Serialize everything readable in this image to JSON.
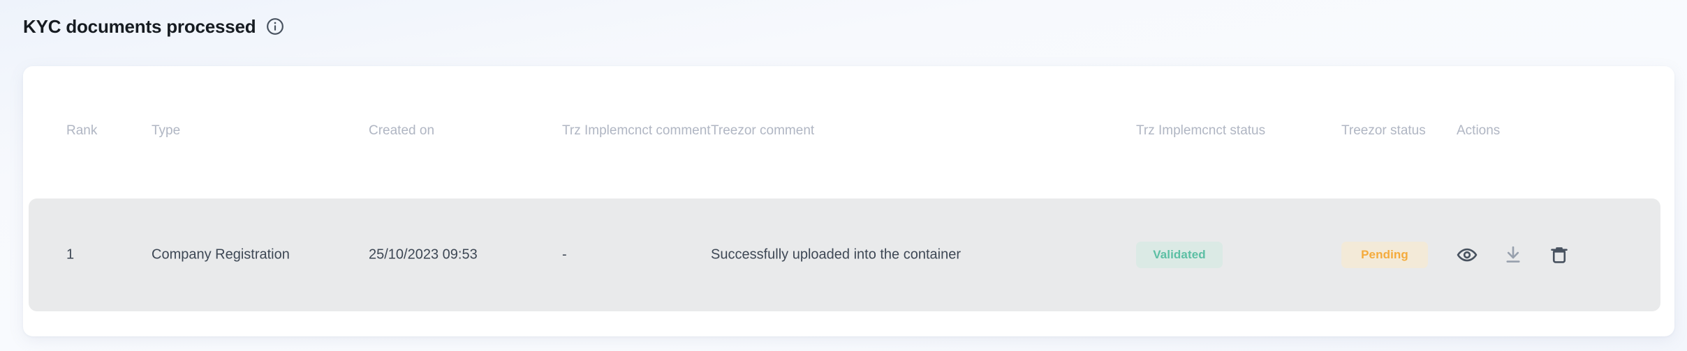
{
  "section": {
    "title": "KYC documents processed",
    "info_icon": "info-circle-icon"
  },
  "table": {
    "columns": [
      {
        "key": "rank",
        "label": "Rank"
      },
      {
        "key": "type",
        "label": "Type"
      },
      {
        "key": "created_on",
        "label": "Created on"
      },
      {
        "key": "trz_implemcnct_comment",
        "label": "Trz Implemcnct comment"
      },
      {
        "key": "treezor_comment",
        "label": "Treezor comment"
      },
      {
        "key": "trz_implemcnct_status",
        "label": "Trz Implemcnct status"
      },
      {
        "key": "treezor_status",
        "label": "Treezor status"
      },
      {
        "key": "actions",
        "label": "Actions"
      }
    ],
    "rows": [
      {
        "rank": "1",
        "type": "Company Registration",
        "created_on": "25/10/2023 09:53",
        "trz_implemcnct_comment": "-",
        "treezor_comment": "Successfully uploaded into the container",
        "trz_implemcnct_status": "Validated",
        "treezor_status": "Pending",
        "actions": [
          {
            "name": "view-icon",
            "title": "View"
          },
          {
            "name": "download-icon",
            "title": "Download"
          },
          {
            "name": "delete-icon",
            "title": "Delete"
          }
        ]
      }
    ]
  },
  "colors": {
    "page_background": "#f7f9fd",
    "card_background": "#ffffff",
    "row_background": "#e9eaeb",
    "header_text": "#b0b6c3",
    "body_text": "#3d4754",
    "title_text": "#161b21",
    "validated_badge_bg": "#dbeae5",
    "validated_badge_text": "#5cbfa4",
    "pending_badge_bg": "#f3ead8",
    "pending_badge_text": "#f4ab3c",
    "icon_primary": "#48525f",
    "icon_secondary": "#97a0ad"
  }
}
